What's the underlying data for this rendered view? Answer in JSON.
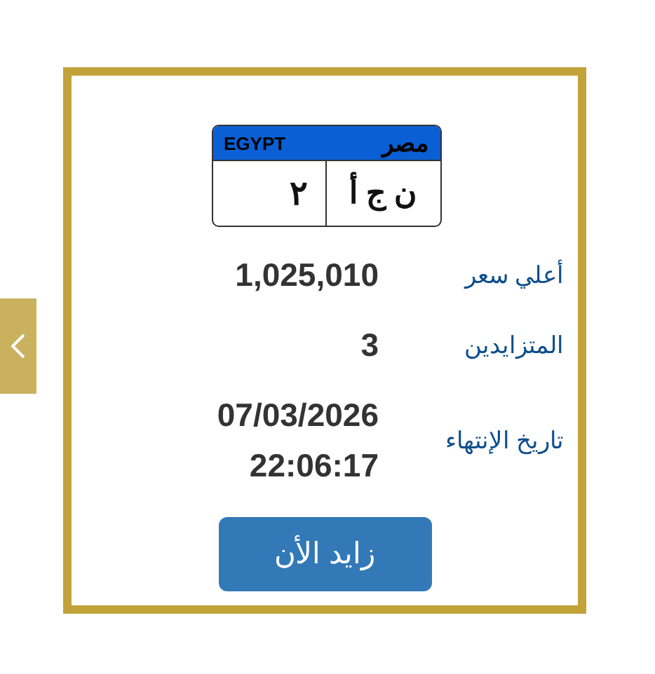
{
  "plate": {
    "country_latin": "EGYPT",
    "country_arabic": "مصر",
    "number": "٢",
    "letters": "ن ج أ"
  },
  "details": [
    {
      "label": "أعلي سعر",
      "value": "1,025,010"
    },
    {
      "label": "المتزايدين",
      "value": "3"
    },
    {
      "label": "تاريخ الإنتهاء",
      "value": "07/03/2026\n22:06:17"
    }
  ],
  "bid_button": "زايد الأن"
}
